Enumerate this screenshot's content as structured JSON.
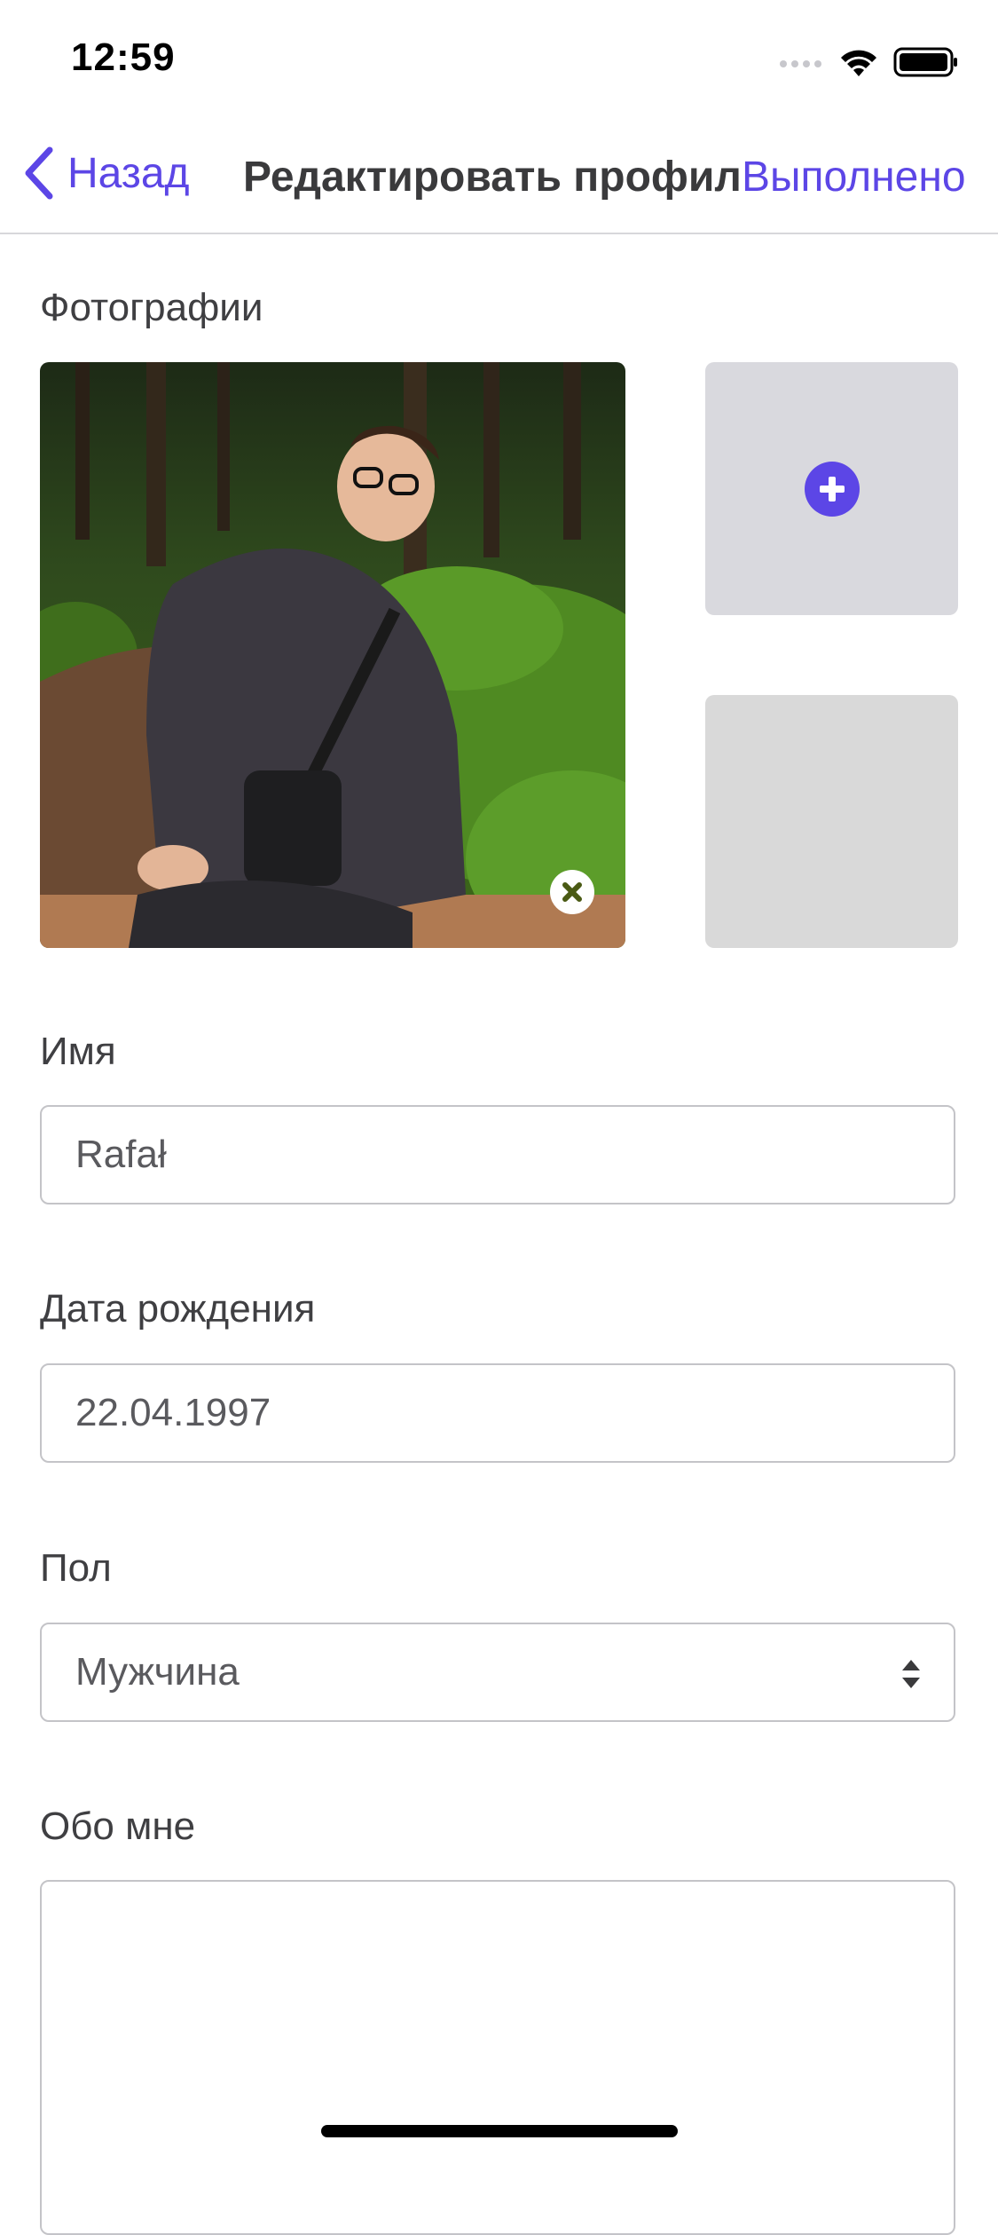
{
  "status_bar": {
    "time": "12:59"
  },
  "nav": {
    "back_label": "Назад",
    "title": "Редактировать профиль",
    "done_label": "Выполнено"
  },
  "photos": {
    "section_label": "Фотографии"
  },
  "name": {
    "label": "Имя",
    "value": "Rafał"
  },
  "birthdate": {
    "label": "Дата рождения",
    "value": "22.04.1997"
  },
  "gender": {
    "label": "Пол",
    "selected": "Мужчина"
  },
  "about": {
    "label": "Обо мне",
    "value": ""
  },
  "colors": {
    "accent": "#5c46e6",
    "field_border": "#c4c4c8",
    "placeholder_slot": "#d9d9de"
  },
  "icons": {
    "back": "chevron-left-icon",
    "add_photo": "plus-circle-icon",
    "remove_photo": "close-circle-icon",
    "select": "up-down-arrows-icon",
    "wifi": "wifi-icon",
    "battery": "battery-icon",
    "signal": "signal-icon"
  }
}
